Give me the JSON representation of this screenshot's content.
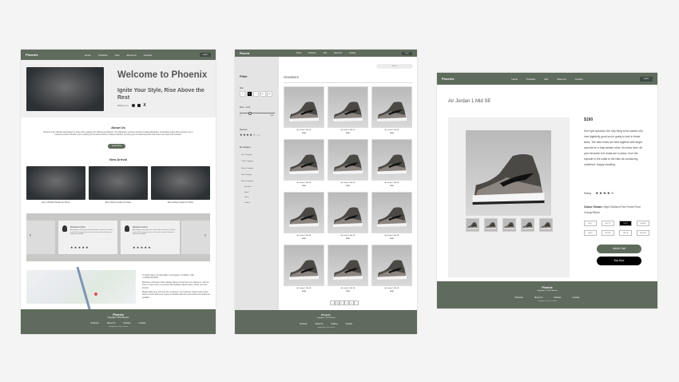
{
  "nav": {
    "brand": "Phoenix",
    "links": [
      "Home",
      "Products",
      "Cart",
      "About Us",
      "Contact"
    ],
    "login": "Log In"
  },
  "home": {
    "welcome": "Welcome to Phoenix",
    "tagline": "Ignite Your Style, Rise Above the Rest",
    "follow": "Follow us on",
    "about_title": "About Us",
    "about_text": "Phoenix is the ultimate destination for those with a passion for clothing and fashion. Our philosophy revolves around providing affordable, trendsetting styles that empower you to express yourself. Whether you're looking for the latest trends or timeless classics, we bring you a curated selection that suits every taste and occasion.",
    "learn_more": "Learn More",
    "new_arrival": "New Arrival",
    "arrivals": [
      "Men's Off-Road Hoodie For Winter",
      "Men's Winter Hoodie For Winter",
      "Men's Winter Hoodie For Winter"
    ],
    "testimonials": [
      {
        "name": "Michael Collins",
        "text": "Absolutely love the quality and fit of the hoodies I purchased. The fabric is soft and the design stands out. Great service and quick delivery too. Highly recommended!"
      },
      {
        "name": "Michael Collins",
        "text": "Absolutely love the quality and fit of the hoodies I purchased. The fabric is soft and the design stands out. Great service and quick delivery too. Highly recommended!"
      }
    ],
    "address": "7A Smith Street, Central Valley, Los Angeles, CA 90001, USA\n+1 (555) 000-0000",
    "contact_text": "Welcome to Phoenix! We're always happy to hear from our customers. Visit our store or reach out to us anytime with questions about orders, sizing, and new arrivals.",
    "contact_text2": "Please allow up to 24 hours for a response. Our customer support team works hard to ensure that every inquiry is handled with care and resolved as quickly as possible."
  },
  "shop": {
    "search_placeholder": "Search",
    "filter": "Filter",
    "size_label": "Size",
    "sizes": [
      "S",
      "M",
      "L",
      "XL",
      "XXL"
    ],
    "selected_size": "M",
    "price_label": "Price - Limit",
    "price_min": "0",
    "price_max": "1000",
    "price_value": 0.3,
    "reviews": "Reviews",
    "rating_count": "(1)",
    "category_label": "By Category",
    "categories": [
      "Shirt Category",
      "T-shirt Category",
      "Shorts Category",
      "Pant Category",
      "Shoes Category"
    ],
    "subcategories": [
      "Sneakers",
      "Boots",
      "Heels",
      "Loafers"
    ],
    "heading": "Sneakers",
    "product_name": "Air Jordan 1 Mid SE",
    "product_price": "$190",
    "pages": [
      "<",
      "1",
      "2",
      "3",
      "4",
      ">"
    ]
  },
  "product": {
    "title": "Air Jordan 1 Mid SE",
    "price": "$190",
    "description": "Don't get spooked: the only thing to be scared of is how frightfully good you're going to look in these kicks. The dark tones are held together with bright accents for a truly sinister shoe. No tricks here: all your favourite AJ1 treats are in place, from the cupsole to the collar to the Nike Air cushioning underfoot. Happy haunting.",
    "rating_label": "Rating",
    "rating": 4.5,
    "colour_label": "Colour Shown:",
    "colour": "Night Stadium/Flat Pewter/Total Orange/Black",
    "sizes": [
      "US 7",
      "US 7.5",
      "US 8",
      "US 8.5",
      "US 9",
      "US 9.5",
      "US 10",
      "US 10.5"
    ],
    "selected_size": "US 8",
    "add_to_cart": "Add to Cart",
    "buy_now": "Buy Now"
  },
  "footer": {
    "title": "Phoenix",
    "copyright": "Copyright © 2024 Phoenix",
    "links": [
      "Products",
      "About Us",
      "Policies",
      "Contact"
    ],
    "note": "Designed by Team Phoenix"
  },
  "colors": {
    "primary": "#5f6b5c",
    "dark": "#3f4a44"
  }
}
